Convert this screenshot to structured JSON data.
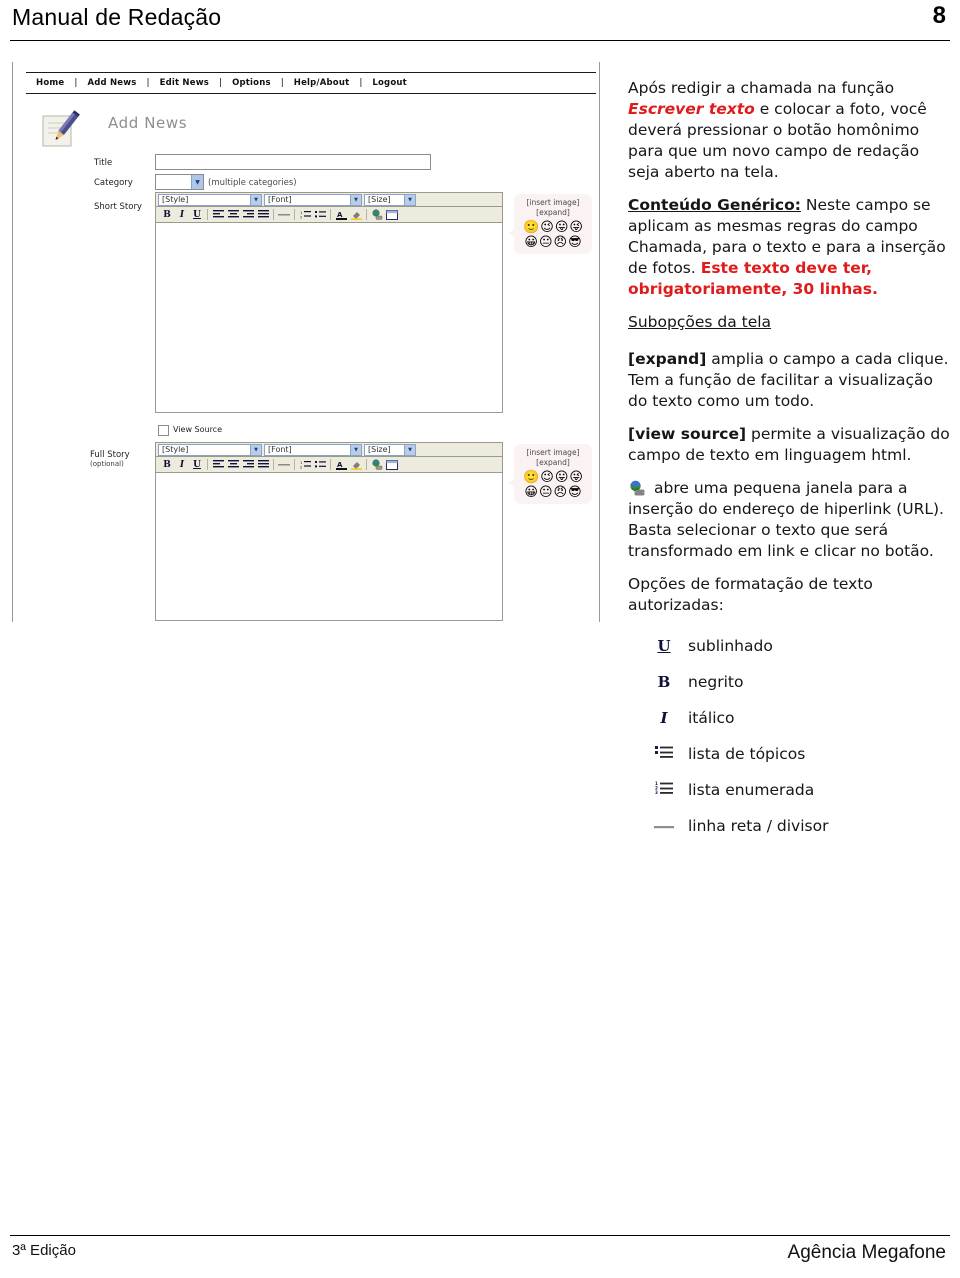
{
  "page": {
    "header_title": "Manual de Redação",
    "page_number": "8"
  },
  "screenshot": {
    "nav": [
      {
        "label": "Home"
      },
      {
        "label": "Add News"
      },
      {
        "label": "Edit News"
      },
      {
        "label": "Options"
      },
      {
        "label": "Help/About"
      },
      {
        "label": "Logout"
      }
    ],
    "nav_separator": "|",
    "panel_title": "Add News",
    "fields": {
      "title_label": "Title",
      "title_value": "",
      "category_label": "Category",
      "category_value": "",
      "category_hint": "(multiple categories)",
      "short_story_label": "Short Story",
      "full_story_label": "Full Story",
      "full_story_sublabel": "(optional)",
      "view_source_label": "View Source"
    },
    "editor_toolbar": {
      "style_dropdown": "[Style]",
      "font_dropdown": "[Font]",
      "size_dropdown": "[Size]",
      "buttons": [
        {
          "name": "bold-button",
          "glyph": "B"
        },
        {
          "name": "italic-button",
          "glyph": "I"
        },
        {
          "name": "underline-button",
          "glyph": "U"
        },
        {
          "name": "align-left-button",
          "glyph": "≣"
        },
        {
          "name": "align-center-button",
          "glyph": "≣"
        },
        {
          "name": "align-right-button",
          "glyph": "≣"
        },
        {
          "name": "align-justify-button",
          "glyph": "≣"
        },
        {
          "name": "horizontal-rule-button",
          "glyph": "—"
        },
        {
          "name": "ordered-list-button",
          "glyph": "≔"
        },
        {
          "name": "unordered-list-button",
          "glyph": "≔"
        },
        {
          "name": "font-color-button",
          "glyph": "A"
        },
        {
          "name": "highlight-color-button",
          "glyph": "✎"
        },
        {
          "name": "insert-link-button",
          "glyph": "🌐"
        },
        {
          "name": "insert-table-button",
          "glyph": "▭"
        }
      ]
    },
    "callout": {
      "line1": "[insert image]",
      "line2": "[expand]",
      "emoticons": [
        "🙂",
        "😉",
        "😛",
        "😜",
        "😀",
        "😐",
        "😠",
        "😎"
      ]
    }
  },
  "content": {
    "p1": {
      "before": "Após redigir a chamada na função ",
      "emphasis": "Escrever texto",
      "after": " e colocar a foto, você deverá pressionar o botão homônimo para que um novo campo de redação seja aberto na tela."
    },
    "p2": {
      "lead": "Conteúdo Genérico:",
      "body": " Neste campo se aplicam as mesmas regras do campo Chamada, para o texto e para a inserção de fotos. ",
      "warning": "Este texto deve ter, obrigatoriamente, 30 linhas."
    },
    "subheading": "Subopções da tela",
    "p3": {
      "term": "[expand]",
      "body": " amplia o campo a cada clique. Tem a função de facilitar a visualização do texto como um todo."
    },
    "p4": {
      "term": "[view source]",
      "body": " permite a visualização do campo de texto em linguagem html."
    },
    "p5": {
      "body": "abre uma pequena janela para a inserção do endereço de hiperlink (URL). Basta selecionar o texto que será transformado em link e clicar no botão."
    },
    "p6": "Opções de formatação de texto autorizadas:",
    "format_options": [
      {
        "icon": "underline-icon",
        "glyph": "U",
        "label": "sublinhado"
      },
      {
        "icon": "bold-icon",
        "glyph": "B",
        "label": "negrito"
      },
      {
        "icon": "italic-icon",
        "glyph": "I",
        "label": "itálico"
      },
      {
        "icon": "bullet-list-icon",
        "glyph": "",
        "label": "lista de tópicos"
      },
      {
        "icon": "numbered-list-icon",
        "glyph": "",
        "label": "lista enumerada"
      },
      {
        "icon": "horizontal-rule-icon",
        "glyph": "",
        "label": "linha reta / divisor"
      }
    ]
  },
  "footer": {
    "edition": "3ª Edição",
    "agency": "Agência Megafone"
  }
}
